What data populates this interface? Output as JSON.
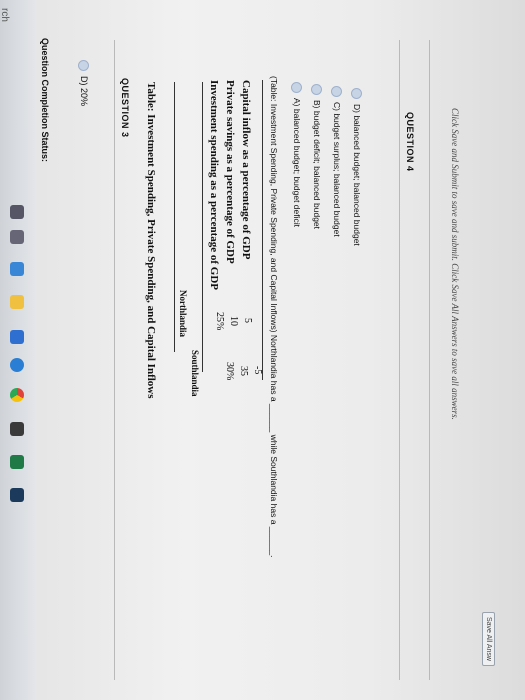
{
  "status": {
    "label": "Question Completion Status:"
  },
  "prev_question": {
    "option_d": "D) 20%"
  },
  "question3": {
    "heading": "QUESTION 3",
    "table_title": "Table: Investment Spending, Private Spending, and Capital Inflows",
    "columns": [
      "Northlandia",
      "Southlandia"
    ],
    "rows": [
      {
        "label": "Investment spending as a percentage of GDP",
        "values": [
          "25%",
          "30%"
        ]
      },
      {
        "label": "Private savings as a percentage of GDP",
        "values": [
          "10",
          "35"
        ]
      },
      {
        "label": "Capital inflow as a percentage of GDP",
        "values": [
          "5",
          "-5"
        ]
      }
    ],
    "prompt": "(Table: Investment Spending, Private Spending, and Capital Inflows) Northlandia has a ______ while Southlandia has a ______.",
    "options": [
      "A) balanced budget; budget deficit",
      "B) budget deficit; balanced budget",
      "C) budget surplus; balanced budget",
      "D) balanced budget; balanced budget"
    ]
  },
  "question4": {
    "heading": "QUESTION 4"
  },
  "footer": {
    "instruction": "Click Save and Submit to save and submit. Click Save All Answers to save all answers.",
    "save_all_label": "Save All Answ"
  },
  "taskbar": {
    "search_label": "rch"
  },
  "colors": {
    "radio_fill": "#c7d4e6",
    "page_bg": "#eeeeee"
  }
}
